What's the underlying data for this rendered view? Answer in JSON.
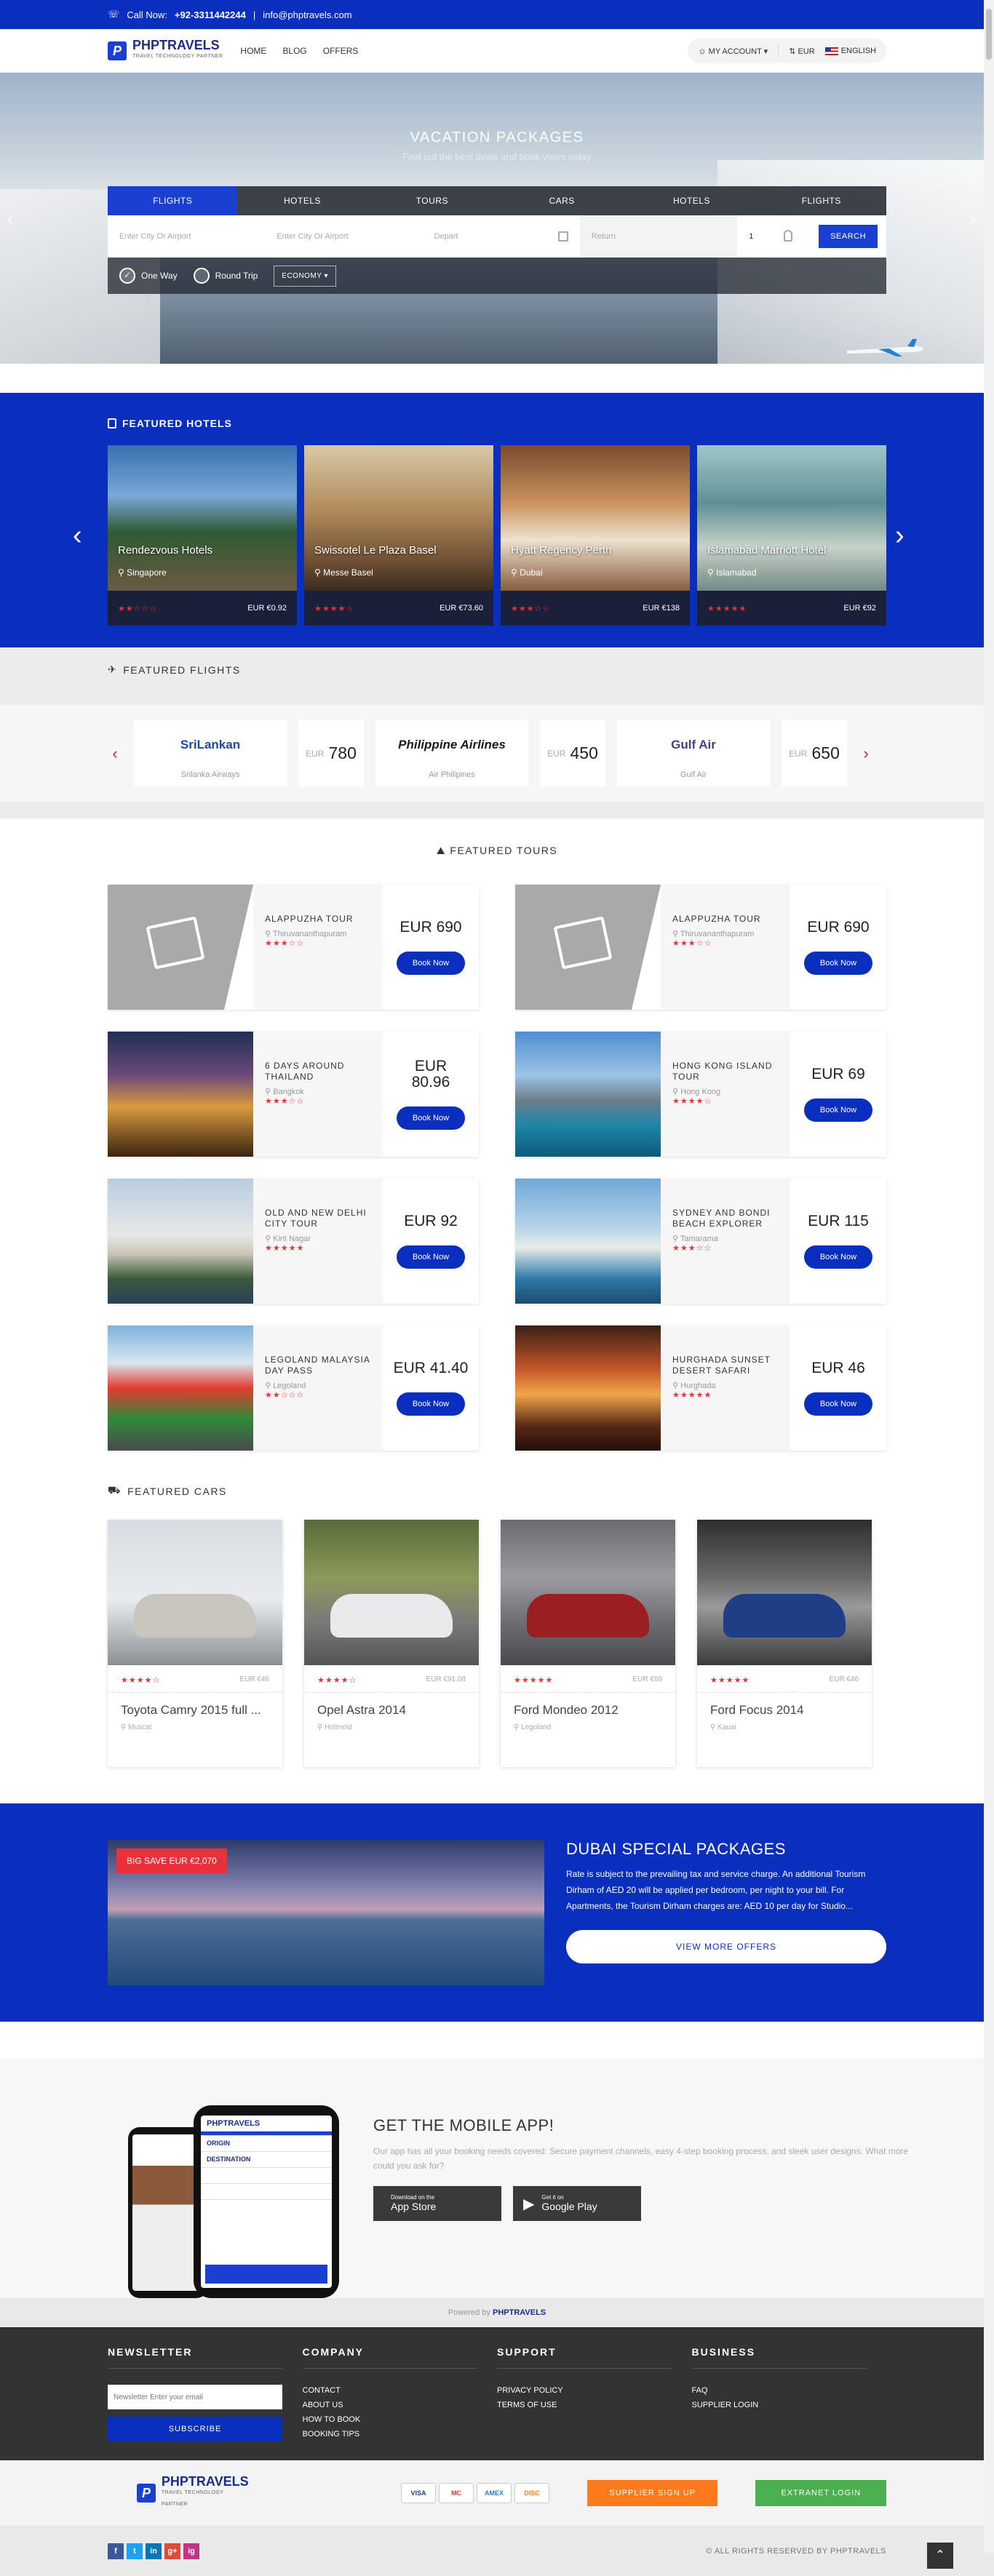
{
  "topbar": {
    "call_label": "Call Now:",
    "phone": "+92-3311442244",
    "separator": "|",
    "email": "info@phptravels.com"
  },
  "header": {
    "logo_text": "PHPTRAVELS",
    "logo_sub": "TRAVEL TECHNOLOGY PARTNER",
    "nav": [
      "HOME",
      "BLOG",
      "OFFERS"
    ],
    "my_account": "MY ACCOUNT",
    "currency": "EUR",
    "language": "ENGLISH"
  },
  "hero": {
    "title": "VACATION PACKAGES",
    "subtitle": "Find out the best deals and book yours today",
    "tabs": [
      "FLIGHTS",
      "HOTELS",
      "TOURS",
      "CARS",
      "HOTELS",
      "FLIGHTS"
    ],
    "from_placeholder": "Enter City Or Airport",
    "to_placeholder": "Enter City Or Airport",
    "depart": "Depart",
    "return": "Return",
    "passengers": "1",
    "search_button": "SEARCH",
    "trip_one_way": "One Way",
    "trip_round": "Round Trip",
    "cabin_class": "ECONOMY"
  },
  "featured_hotels": {
    "title": "FEATURED HOTELS",
    "items": [
      {
        "name": "Rendezvous Hotels",
        "location": "Singapore",
        "stars": "★★☆☆☆",
        "price": "EUR €0.92"
      },
      {
        "name": "Swissotel Le Plaza Basel",
        "location": "Messe Basel",
        "stars": "★★★★☆",
        "price": "EUR €73.60"
      },
      {
        "name": "Hyatt Regency Perth",
        "location": "Dubai",
        "stars": "★★★☆☆",
        "price": "EUR €138"
      },
      {
        "name": "Islamabad Marriott Hotel",
        "location": "Islamabad",
        "stars": "★★★★★",
        "price": "EUR €92"
      }
    ]
  },
  "featured_flights": {
    "title": "FEATURED FLIGHTS",
    "items": [
      {
        "logo": "SriLankan",
        "name": "Srilanka Airways",
        "currency": "EUR",
        "price": "780"
      },
      {
        "logo": "Philippine Airlines",
        "name": "Air Philipines",
        "currency": "EUR",
        "price": "450"
      },
      {
        "logo": "Gulf Air",
        "name": "Gulf Air",
        "currency": "EUR",
        "price": "650"
      }
    ]
  },
  "featured_tours": {
    "title": "FEATURED TOURS",
    "book_label": "Book Now",
    "items": [
      {
        "name": "ALAPPUZHA TOUR",
        "location": "Thiruvananthapuram",
        "stars": "★★★☆☆",
        "price": "EUR 690"
      },
      {
        "name": "ALAPPUZHA TOUR",
        "location": "Thiruvananthapuram",
        "stars": "★★★☆☆",
        "price": "EUR 690"
      },
      {
        "name": "6 DAYS AROUND THAILAND",
        "location": "Bangkok",
        "stars": "★★★☆☆",
        "price": "EUR 80.96"
      },
      {
        "name": "HONG KONG ISLAND TOUR",
        "location": "Hong Kong",
        "stars": "★★★★☆",
        "price": "EUR 69"
      },
      {
        "name": "OLD AND NEW DELHI CITY TOUR",
        "location": "Kirti Nagar",
        "stars": "★★★★★",
        "price": "EUR 92"
      },
      {
        "name": "SYDNEY AND BONDI BEACH EXPLORER",
        "location": "Tamarama",
        "stars": "★★★☆☆",
        "price": "EUR 115"
      },
      {
        "name": "LEGOLAND MALAYSIA DAY PASS",
        "location": "Legoland",
        "stars": "★★☆☆☆",
        "price": "EUR 41.40"
      },
      {
        "name": "HURGHADA SUNSET DESERT SAFARI",
        "location": "Hurghada",
        "stars": "★★★★★",
        "price": "EUR 46"
      }
    ]
  },
  "featured_cars": {
    "title": "FEATURED CARS",
    "items": [
      {
        "name": "Toyota Camry 2015 full ...",
        "location": "Muscat",
        "stars": "★★★★☆",
        "price": "EUR €46"
      },
      {
        "name": "Opel Astra 2014",
        "location": "Hotmeld",
        "stars": "★★★★☆",
        "price": "EUR €91.08"
      },
      {
        "name": "Ford Mondeo 2012",
        "location": "Legoland",
        "stars": "★★★★★",
        "price": "EUR €69"
      },
      {
        "name": "Ford Focus 2014",
        "location": "Kauai",
        "stars": "★★★★★",
        "price": "EUR €46"
      }
    ]
  },
  "dubai": {
    "badge_label": "BIG SAVE",
    "badge_price": "EUR €2,070",
    "title": "DUBAI SPECIAL PACKAGES",
    "text": "Rate is subject to the prevailing tax and service charge. An additional Tourism Dirham of AED 20 will be applied per bedroom, per night to your bill. For Apartments, the Tourism Dirham charges are: AED 10 per day for Studio...",
    "button": "VIEW MORE OFFERS"
  },
  "mobile_app": {
    "title": "GET THE MOBILE APP!",
    "text": "Our app has all your booking needs covered: Secure payment channels, easy 4-step booking process, and sleek user designs. What more could you ask for?",
    "appstore_small": "Download on the",
    "appstore": "App Store",
    "play_small": "Get it on",
    "play": "Google Play",
    "app_origin": "ORIGIN",
    "app_destination": "DESTINATION"
  },
  "powered": {
    "label": "Powered by",
    "brand": "PHPTRAVELS"
  },
  "footer": {
    "newsletter_title": "NEWSLETTER",
    "newsletter_placeholder": "Newsletter Enter your email",
    "subscribe": "SUBSCRIBE",
    "company_title": "COMPANY",
    "company_links": [
      "CONTACT",
      "ABOUT US",
      "HOW TO BOOK",
      "BOOKING TIPS"
    ],
    "support_title": "SUPPORT",
    "support_links": [
      "PRIVACY POLICY",
      "TERMS OF USE"
    ],
    "business_title": "BUSINESS",
    "business_links": [
      "FAQ",
      "SUPPLIER LOGIN"
    ]
  },
  "subfooter": {
    "cards": [
      "VISA",
      "MC",
      "AMEX",
      "DISC"
    ],
    "supplier_signup": "SUPPLIER SIGN UP",
    "extranet_login": "EXTRANET LOGIN"
  },
  "bottom": {
    "socials": [
      "f",
      "t",
      "in",
      "g+",
      "ig"
    ],
    "copyright": "© ALL RIGHTS RESERVED BY PHPTRAVELS"
  },
  "colors": {
    "brand_blue": "#0a2fbf",
    "accent_red": "#e8313a",
    "orange": "#ff7a1a",
    "green": "#4caf50"
  }
}
